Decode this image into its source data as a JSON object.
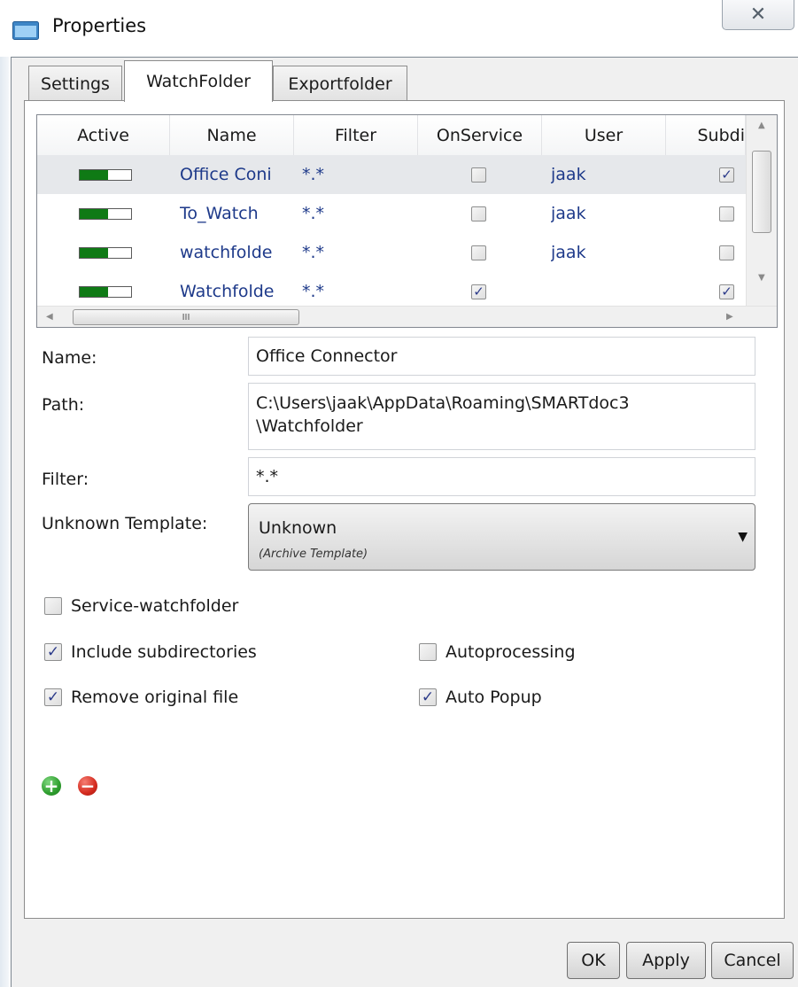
{
  "window": {
    "title": "Properties",
    "close_glyph": "✕",
    "icon": "window-app-icon"
  },
  "tabs": [
    {
      "label": "Settings",
      "active": false
    },
    {
      "label": "WatchFolder",
      "active": true
    },
    {
      "label": "Exportfolder",
      "active": false
    }
  ],
  "grid": {
    "columns": [
      "Active",
      "Name",
      "Filter",
      "OnService",
      "User",
      "Subdi"
    ],
    "rows": [
      {
        "active": true,
        "name": "Office Coni",
        "filter": "*.*",
        "on_service": false,
        "user": "jaak",
        "subdirs": true,
        "selected": true
      },
      {
        "active": true,
        "name": "To_Watch",
        "filter": "*.*",
        "on_service": false,
        "user": "jaak",
        "subdirs": false,
        "selected": false
      },
      {
        "active": true,
        "name": "watchfolde",
        "filter": "*.*",
        "on_service": false,
        "user": "jaak",
        "subdirs": false,
        "selected": false
      },
      {
        "active": true,
        "name": "Watchfolde",
        "filter": "*.*",
        "on_service": true,
        "user": "",
        "subdirs": true,
        "selected": false
      }
    ],
    "hscroll_grip": "III"
  },
  "form": {
    "name_label": "Name:",
    "name_value": "Office Connector",
    "path_label": "Path:",
    "path_line1": "C:\\Users\\jaak\\AppData\\Roaming\\SMARTdoc3",
    "path_line2": "\\Watchfolder",
    "filter_label": "Filter:",
    "filter_value": "*.*",
    "template_label": "Unknown Template:",
    "template_value": "Unknown",
    "template_sub": "(Archive Template)"
  },
  "options": {
    "service_watchfolder": {
      "label": "Service-watchfolder",
      "checked": false
    },
    "include_subdirectories": {
      "label": "Include subdirectories",
      "checked": true
    },
    "remove_original": {
      "label": "Remove original file",
      "checked": true
    },
    "autoprocessing": {
      "label": "Autoprocessing",
      "checked": false
    },
    "auto_popup": {
      "label": "Auto Popup",
      "checked": true
    }
  },
  "actions": {
    "add_icon": "plus-circle-icon",
    "remove_icon": "minus-circle-icon"
  },
  "buttons": {
    "ok": "OK",
    "apply": "Apply",
    "cancel": "Cancel"
  },
  "colors": {
    "toggle_on": "#0f7a15",
    "add": "#2e9e2e",
    "remove": "#d42a1e",
    "link_text": "#1e3a8a"
  }
}
